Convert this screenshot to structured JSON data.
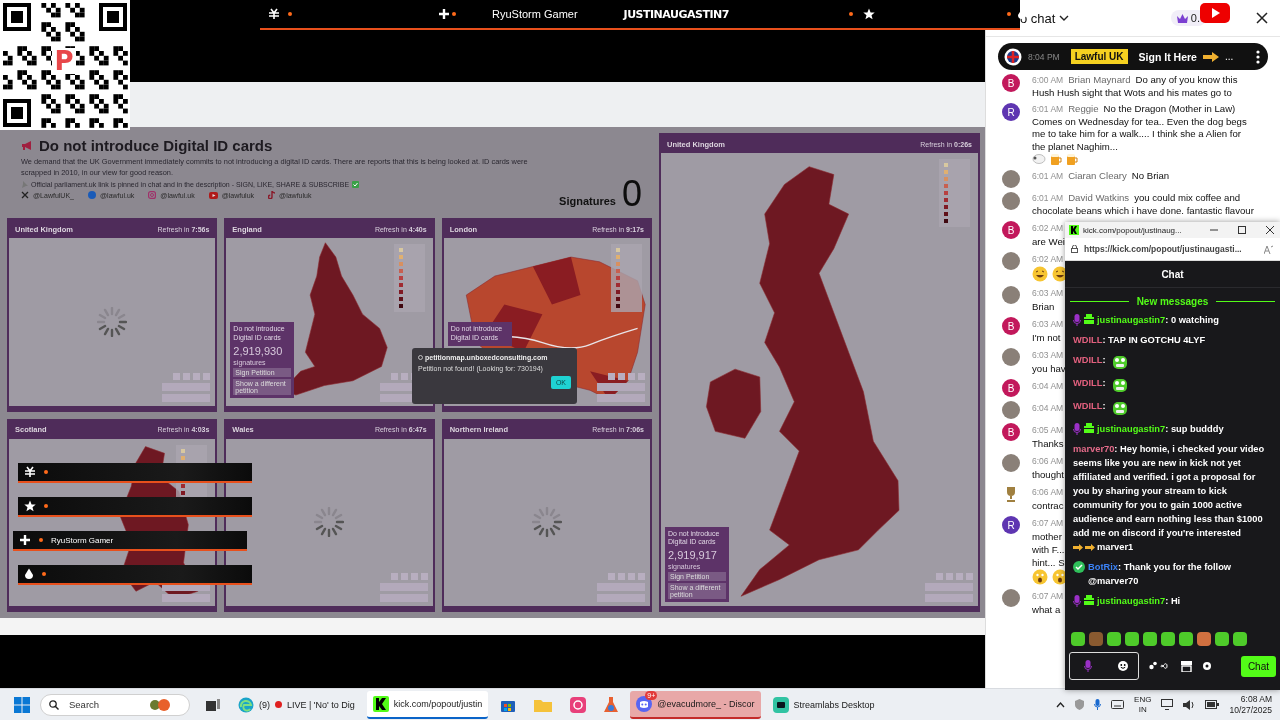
{
  "stream": {
    "qr_logo": "P",
    "ticker": {
      "labels": [
        "RyuStorm Gamer",
        "JUSTINAUGASTIN7"
      ]
    },
    "side_ticker": {
      "label": "RyuStorm Gamer"
    }
  },
  "petition": {
    "title": "Do not introduce Digital ID cards",
    "description": "We demand that the UK Government immediately commits to not introducing a digital ID cards. There are reports that this is being looked at. ID cards were scrapped in 2010, in our view for good reason.",
    "note": "Official parliament.uk link is pinned in chat and in the description - SIGN, LIKE, SHARE & SUBSCRIBE",
    "socials": [
      {
        "kind": "x",
        "handle": "@LawfulUK_"
      },
      {
        "kind": "facebook",
        "handle": "@lawful.uk"
      },
      {
        "kind": "instagram",
        "handle": "@lawful.uk"
      },
      {
        "kind": "youtube",
        "handle": "@lawfuluk"
      },
      {
        "kind": "tiktok",
        "handle": "@lawfuluk"
      }
    ],
    "signatures_label": "Signatures",
    "signatures_count": "0",
    "panels": [
      {
        "title": "United Kingdom",
        "refresh": "Refresh in **7:56s**",
        "kind": "loading",
        "legend": false
      },
      {
        "title": "England",
        "refresh": "Refresh in **4:40s**",
        "kind": "map",
        "legend": true,
        "info": {
          "title": "Do not introduce Digital ID cards",
          "count": "2,919,930",
          "unit": "signatures",
          "buttons": [
            "Sign Petition",
            "Show a different petition"
          ]
        }
      },
      {
        "title": "London",
        "refresh": "Refresh in **9:17s**",
        "kind": "map",
        "legend": true,
        "info": {
          "title": "Do not introduce Digital ID cards"
        }
      },
      {
        "title": "Scotland",
        "refresh": "Refresh in **4:03s**",
        "kind": "map",
        "legend": true
      },
      {
        "title": "Wales",
        "refresh": "Refresh in **6:47s**",
        "kind": "loading",
        "legend": false
      },
      {
        "title": "Northern Ireland",
        "refresh": "Refresh in **7:06s**",
        "kind": "loading",
        "legend": false
      }
    ],
    "main_panel": {
      "title": "United Kingdom",
      "refresh": "Refresh in **0:26s**",
      "kind": "map",
      "legend": true,
      "info": {
        "title": "Do not introduce Digital ID cards",
        "count": "2,919,917",
        "unit": "signatures",
        "buttons": [
          "Sign Petition",
          "Show a different petition"
        ]
      }
    },
    "dialog": {
      "site": "petitionmap.unboxedconsulting.com",
      "message": "Petition not found! (Looking for: 730194)",
      "button": "OK"
    }
  },
  "chat": {
    "title": "o chat",
    "points": "0.",
    "pinned": {
      "time": "8:04 PM",
      "author": "Lawful UK",
      "text": "Sign It Here",
      "suffix": "..."
    },
    "messages": [
      {
        "avatar": {
          "kind": "letter",
          "letter": "B",
          "color": "#c2185b"
        },
        "time": "6:00 AM",
        "author": "Brian Maynard",
        "text": "Do any of you know this Hush Hush sight that Wots and his mates go to"
      },
      {
        "avatar": {
          "kind": "letter",
          "letter": "R",
          "color": "#5e35b1"
        },
        "time": "6:01 AM",
        "author": "Reggie",
        "text": "No the Dragon (Mother in Law) Comes on Wednesday for tea.. Even the dog begs me to take him for a walk.... I think she a Alien for the planet Naghim...",
        "emojis": [
          {
            "kind": "sheep"
          },
          {
            "kind": "beer"
          },
          {
            "kind": "beer"
          }
        ]
      },
      {
        "avatar": {
          "kind": "photo"
        },
        "time": "6:01 AM",
        "author": "Ciaran Cleary",
        "text": "No Brian"
      },
      {
        "avatar": {
          "kind": "photo"
        },
        "time": "6:01 AM",
        "author": "David Watkins",
        "text": "you could mix coffee and chocolate beans which i have done. fantastic flavour"
      },
      {
        "avatar": {
          "kind": "letter",
          "letter": "B",
          "color": "#c2185b"
        },
        "time": "6:02 AM",
        "lines": [
          "are Wei"
        ]
      },
      {
        "avatar": {
          "kind": "photo"
        },
        "time": "6:02 AM",
        "emojis": [
          {
            "kind": "laugh"
          },
          {
            "kind": "laugh"
          }
        ]
      },
      {
        "avatar": {
          "kind": "photo"
        },
        "time": "6:03 AM",
        "lines": [
          "Brian"
        ]
      },
      {
        "avatar": {
          "kind": "letter",
          "letter": "B",
          "color": "#c2185b"
        },
        "time": "6:03 AM",
        "lines": [
          "I'm not"
        ]
      },
      {
        "avatar": {
          "kind": "photo"
        },
        "time": "6:03 AM",
        "lines": [
          "you hav"
        ]
      },
      {
        "avatar": {
          "kind": "letter",
          "letter": "B",
          "color": "#c2185b"
        },
        "time": "6:04 AM"
      },
      {
        "avatar": {
          "kind": "photo"
        },
        "time": "6:04 AM"
      },
      {
        "avatar": {
          "kind": "letter",
          "letter": "B",
          "color": "#c2185b"
        },
        "time": "6:05 AM",
        "lines": [
          "Thanks"
        ]
      },
      {
        "avatar": {
          "kind": "photo"
        },
        "time": "6:06 AM",
        "lines": [
          "thought"
        ]
      },
      {
        "avatar": {
          "kind": "trophy"
        },
        "time": "6:06 AM",
        "lines": [
          "contrac"
        ]
      },
      {
        "avatar": {
          "kind": "letter",
          "letter": "R",
          "color": "#5e35b1"
        },
        "time": "6:07 AM",
        "lines": [
          "mother",
          "with F...",
          "hint... S"
        ],
        "emojis": [
          {
            "kind": "shock"
          },
          {
            "kind": "shock"
          }
        ]
      },
      {
        "avatar": {
          "kind": "photo"
        },
        "time": "6:07 AM",
        "lines": [
          "what a"
        ]
      }
    ]
  },
  "popup": {
    "tab_title": "kick.com/popout/justinaug...",
    "url": "https://kick.com/popout/justinaugasti...",
    "heading": "Chat",
    "divider": "New messages",
    "send_label": "Chat",
    "messages": [
      {
        "badges": [
          {
            "kind": "mic"
          },
          {
            "kind": "gift"
          }
        ],
        "user": "justinaugastin7",
        "color": "#53fc18",
        "text": ": 0 watching"
      },
      {
        "user": "WDILL",
        "color": "#e2607e",
        "text": ": TAP IN GOTCHU 4LYF"
      },
      {
        "user": "WDILL",
        "color": "#e2607e",
        "text": ":",
        "emote": {
          "kind": "frog"
        }
      },
      {
        "user": "WDILL",
        "color": "#e2607e",
        "text": ":",
        "emote": {
          "kind": "frog"
        }
      },
      {
        "user": "WDILL",
        "color": "#e2607e",
        "text": ":",
        "emote": {
          "kind": "frog"
        }
      },
      {
        "badges": [
          {
            "kind": "mic"
          },
          {
            "kind": "gift"
          }
        ],
        "user": "justinaugastin7",
        "color": "#53fc18",
        "text": ": sup budddy"
      },
      {
        "user": "marver70",
        "color": "#e56b8a",
        "text": ": Hey homie, i checked your video seems like you are new in kick not yet affiliated and verified. i got a proposal for you by sharing your stream to kick community for you to gain 1000 active audience and earn nothing less than $1000 add me on discord if you're interested",
        "emote": {
          "kind": "point"
        },
        "tail": "marver1"
      },
      {
        "badges": [
          {
            "kind": "verified"
          }
        ],
        "user": "BotRix",
        "color": "#3b82f6",
        "text": ": Thank you for the follow @marver70"
      },
      {
        "badges": [
          {
            "kind": "mic"
          },
          {
            "kind": "gift"
          }
        ],
        "user": "justinaugastin7",
        "color": "#53fc18",
        "text": ": Hi"
      }
    ]
  },
  "taskbar": {
    "search_placeholder": "Search",
    "apps": [
      {
        "kind": "taskview",
        "selected": false,
        "flashing": false
      },
      {
        "kind": "edge",
        "count": "(9)",
        "recording": true,
        "label": "LIVE | 'No' to Dig",
        "selected": false,
        "flashing": false
      },
      {
        "kind": "kick",
        "label": "kick.com/popout/justin",
        "selected": true,
        "flashing": false
      },
      {
        "kind": "store",
        "selected": false,
        "flashing": false
      },
      {
        "kind": "folder",
        "selected": false,
        "flashing": false
      },
      {
        "kind": "photos",
        "selected": false,
        "flashing": false
      },
      {
        "kind": "flask",
        "selected": false,
        "flashing": false
      },
      {
        "kind": "discord",
        "badge": "9+",
        "label": "@evacudmore_ - Discor",
        "selected": false,
        "flashing": true
      },
      {
        "kind": "streamlabs",
        "label": "Streamlabs Desktop",
        "selected": false,
        "flashing": false
      }
    ],
    "lang": "ENG",
    "region": "IN",
    "time": "6:08 AM",
    "date": "10/27/2025"
  }
}
